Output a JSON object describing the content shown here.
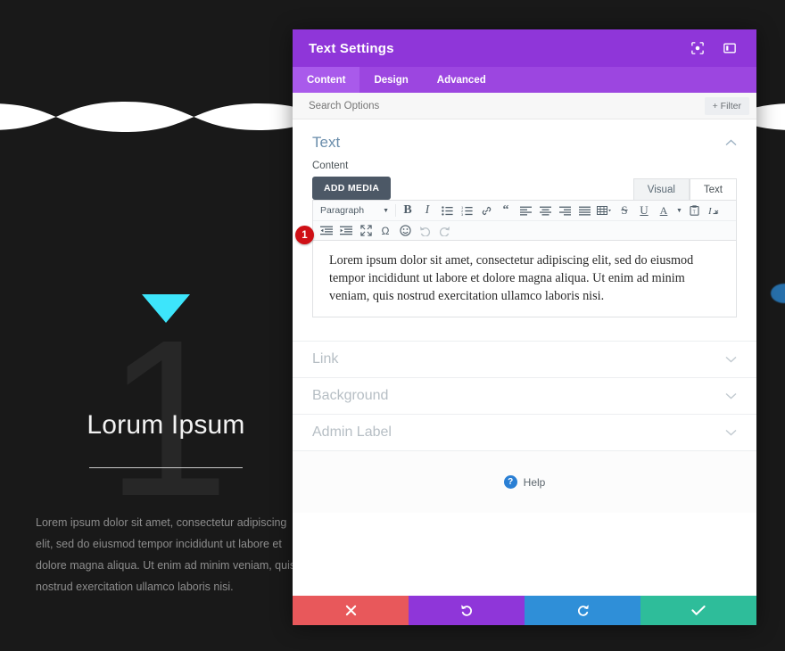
{
  "background_page": {
    "hero_triangle_color": "#3de5fb",
    "big_number": "1",
    "title": "Lorum Ipsum",
    "body": "Lorem ipsum dolor sit amet, consectetur adipiscing elit, sed do eiusmod tempor incididunt ut labore et dolore magna aliqua. Ut enim ad minim veniam, quis nostrud exercitation ullamco laboris nisi.",
    "page_bg_color": "#191919",
    "wave_color": "#ffffff",
    "right_edge_nub_color": "#2a7fc4"
  },
  "modal": {
    "title": "Text Settings",
    "header_color": "#8f36d9",
    "header_icons": [
      {
        "name": "fullscreen-preview-icon",
        "label": "Preview"
      },
      {
        "name": "layout-panel-icon",
        "label": "Panel Position"
      }
    ],
    "tabs": [
      {
        "label": "Content",
        "active": true
      },
      {
        "label": "Design",
        "active": false
      },
      {
        "label": "Advanced",
        "active": false
      }
    ],
    "search": {
      "placeholder": "Search Options",
      "value": ""
    },
    "filter_button": {
      "label": "Filter",
      "icon": "plus-icon"
    },
    "text_section": {
      "title": "Text",
      "collapse_icon": "chevron-up-icon",
      "field_label": "Content",
      "add_media_label": "ADD MEDIA",
      "editor_tabs": [
        {
          "label": "Visual",
          "active": false
        },
        {
          "label": "Text",
          "active": true
        }
      ],
      "toolbar_row1": [
        {
          "name": "paragraph-format-select",
          "label": "Paragraph",
          "type": "select"
        },
        {
          "name": "bold-icon",
          "label": "B",
          "type": "icon"
        },
        {
          "name": "italic-icon",
          "label": "I",
          "type": "icon"
        },
        {
          "name": "bullet-list-icon",
          "label": "Unordered list",
          "type": "icon"
        },
        {
          "name": "numbered-list-icon",
          "label": "Ordered list",
          "type": "icon"
        },
        {
          "name": "link-icon",
          "label": "Insert link",
          "type": "icon"
        },
        {
          "name": "blockquote-icon",
          "label": "Blockquote",
          "type": "icon"
        },
        {
          "name": "align-left-icon",
          "label": "Align left",
          "type": "icon"
        },
        {
          "name": "align-center-icon",
          "label": "Align center",
          "type": "icon"
        },
        {
          "name": "align-right-icon",
          "label": "Align right",
          "type": "icon"
        },
        {
          "name": "align-justify-icon",
          "label": "Justify",
          "type": "icon"
        },
        {
          "name": "table-icon",
          "label": "Table",
          "type": "icon"
        },
        {
          "name": "strikethrough-icon",
          "label": "S",
          "type": "icon"
        },
        {
          "name": "underline-icon",
          "label": "U",
          "type": "icon"
        },
        {
          "name": "text-color-icon",
          "label": "A",
          "type": "icon"
        },
        {
          "name": "paste-as-text-icon",
          "label": "Paste as text",
          "type": "icon"
        },
        {
          "name": "clear-formatting-icon",
          "label": "Clear formatting",
          "type": "icon"
        }
      ],
      "toolbar_row2": [
        {
          "name": "outdent-icon",
          "label": "Decrease indent",
          "type": "icon"
        },
        {
          "name": "indent-icon",
          "label": "Increase indent",
          "type": "icon"
        },
        {
          "name": "fullscreen-icon",
          "label": "Fullscreen",
          "type": "icon"
        },
        {
          "name": "special-character-icon",
          "label": "Ω",
          "type": "icon"
        },
        {
          "name": "emoji-icon",
          "label": "Emoji",
          "type": "icon"
        },
        {
          "name": "undo-icon",
          "label": "Undo",
          "type": "icon",
          "disabled": true
        },
        {
          "name": "redo-icon",
          "label": "Redo",
          "type": "icon",
          "disabled": true
        }
      ],
      "content_value": "Lorem ipsum dolor sit amet, consectetur adipiscing elit, sed do eiusmod tempor incididunt ut labore et dolore magna aliqua. Ut enim ad minim veniam, quis nostrud exercitation ullamco laboris nisi.",
      "step_badge": "1",
      "step_badge_color": "#cf1016"
    },
    "collapsed_sections": [
      {
        "title": "Link",
        "icon": "chevron-down-icon"
      },
      {
        "title": "Background",
        "icon": "chevron-down-icon"
      },
      {
        "title": "Admin Label",
        "icon": "chevron-down-icon"
      }
    ],
    "help": {
      "label": "Help",
      "icon": "question-circle-icon"
    },
    "footer_buttons": [
      {
        "name": "cancel-button",
        "icon": "close-icon",
        "color": "#e8585b"
      },
      {
        "name": "undo-button",
        "icon": "undo-icon",
        "color": "#8f36d9"
      },
      {
        "name": "redo-button",
        "icon": "redo-icon",
        "color": "#2f8fd8"
      },
      {
        "name": "save-button",
        "icon": "check-icon",
        "color": "#2ebd9a"
      }
    ]
  }
}
